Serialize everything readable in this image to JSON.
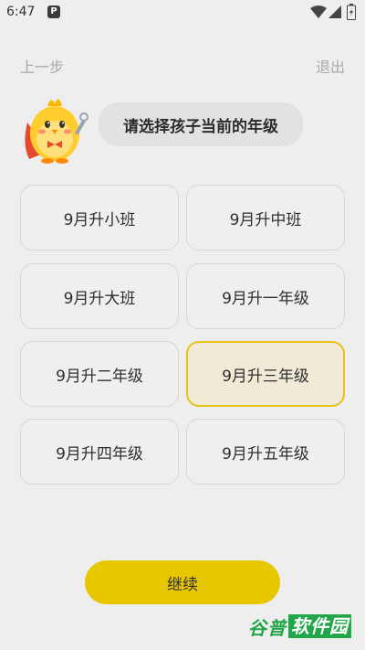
{
  "status_bar": {
    "time": "6:47",
    "app_badge": "P"
  },
  "nav": {
    "back_label": "上一步",
    "exit_label": "退出"
  },
  "prompt": {
    "text": "请选择孩子当前的年级"
  },
  "grades": [
    {
      "label": "9月升小班",
      "selected": false
    },
    {
      "label": "9月升中班",
      "selected": false
    },
    {
      "label": "9月升大班",
      "selected": false
    },
    {
      "label": "9月升一年级",
      "selected": false
    },
    {
      "label": "9月升二年级",
      "selected": false
    },
    {
      "label": "9月升三年级",
      "selected": true
    },
    {
      "label": "9月升四年级",
      "selected": false
    },
    {
      "label": "9月升五年级",
      "selected": false
    }
  ],
  "continue_label": "继续",
  "watermark": {
    "prefix": "谷普",
    "suffix": "软件园"
  },
  "colors": {
    "accent": "#e7c700",
    "selected_bg": "#f1ead6",
    "selected_border": "#e6c21a",
    "background": "#eeeeee"
  }
}
